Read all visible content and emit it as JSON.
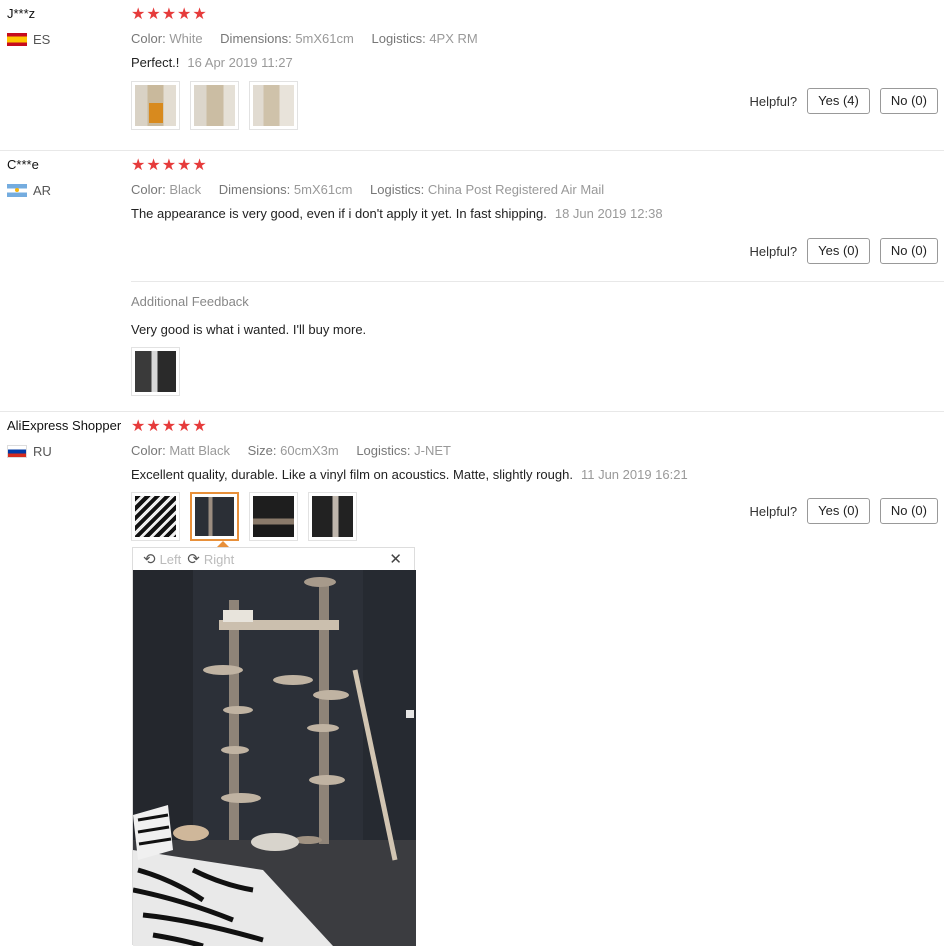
{
  "reviews": [
    {
      "user": "J***z",
      "country": "ES",
      "stars": "★★★★★",
      "attributes": [
        {
          "key": "Color:",
          "value": "White"
        },
        {
          "key": "Dimensions:",
          "value": "5mX61cm"
        },
        {
          "key": "Logistics:",
          "value": "4PX RM"
        }
      ],
      "feedback": "Perfect.!",
      "date": "16 Apr 2019 11:27",
      "helpful_label": "Helpful?",
      "yes_label": "Yes (4)",
      "no_label": "No (0)"
    },
    {
      "user": "C***e",
      "country": "AR",
      "stars": "★★★★★",
      "attributes": [
        {
          "key": "Color:",
          "value": "Black"
        },
        {
          "key": "Dimensions:",
          "value": "5mX61cm"
        },
        {
          "key": "Logistics:",
          "value": "China Post Registered Air Mail"
        }
      ],
      "feedback": "The appearance is very good, even if i don't apply it yet. In fast shipping.",
      "date": "18 Jun 2019 12:38",
      "helpful_label": "Helpful?",
      "yes_label": "Yes (0)",
      "no_label": "No (0)",
      "additional_title": "Additional Feedback",
      "additional_text": "Very good is what i wanted. I'll buy more."
    },
    {
      "user": "AliExpress Shopper",
      "country": "RU",
      "stars": "★★★★★",
      "attributes": [
        {
          "key": "Color:",
          "value": "Matt Black"
        },
        {
          "key": "Size:",
          "value": "60cmX3m"
        },
        {
          "key": "Logistics:",
          "value": "J-NET"
        }
      ],
      "feedback": "Excellent quality, durable. Like a vinyl film on acoustics. Matte, slightly rough.",
      "date": "11 Jun 2019 16:21",
      "helpful_label": "Helpful?",
      "yes_label": "Yes (0)",
      "no_label": "No (0)",
      "viewer": {
        "rotate_left": "Left",
        "rotate_right": "Right",
        "close": "✕"
      }
    }
  ],
  "colors": {
    "star": "#e63b3b",
    "selected_thumb": "#e8903a"
  }
}
